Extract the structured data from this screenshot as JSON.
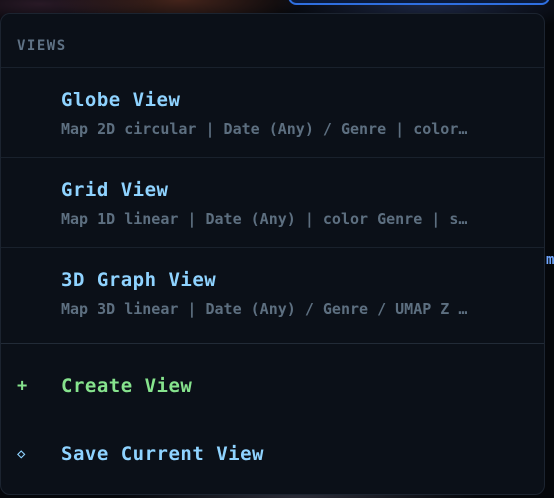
{
  "menu": {
    "section_title": "VIEWS",
    "views": [
      {
        "title": "Globe View",
        "description": "Map 2D circular | Date (Any) / Genre | color…"
      },
      {
        "title": "Grid View",
        "description": "Map 1D linear | Date (Any) | color Genre | s…"
      },
      {
        "title": "3D Graph View",
        "description": "Map 3D linear | Date (Any) / Genre / UMAP Z …"
      }
    ],
    "create_action": {
      "icon": "+",
      "label": "Create View"
    },
    "save_action": {
      "icon": "◇",
      "label": "Save Current View"
    }
  },
  "background": {
    "edge_glyph": "m"
  },
  "colors": {
    "panel_bg": "#0b1018",
    "title": "#8fd3ff",
    "description": "#5d6f80",
    "section_header": "#5f7285",
    "create_accent": "#86e38d",
    "save_accent": "#8fd3ff"
  }
}
